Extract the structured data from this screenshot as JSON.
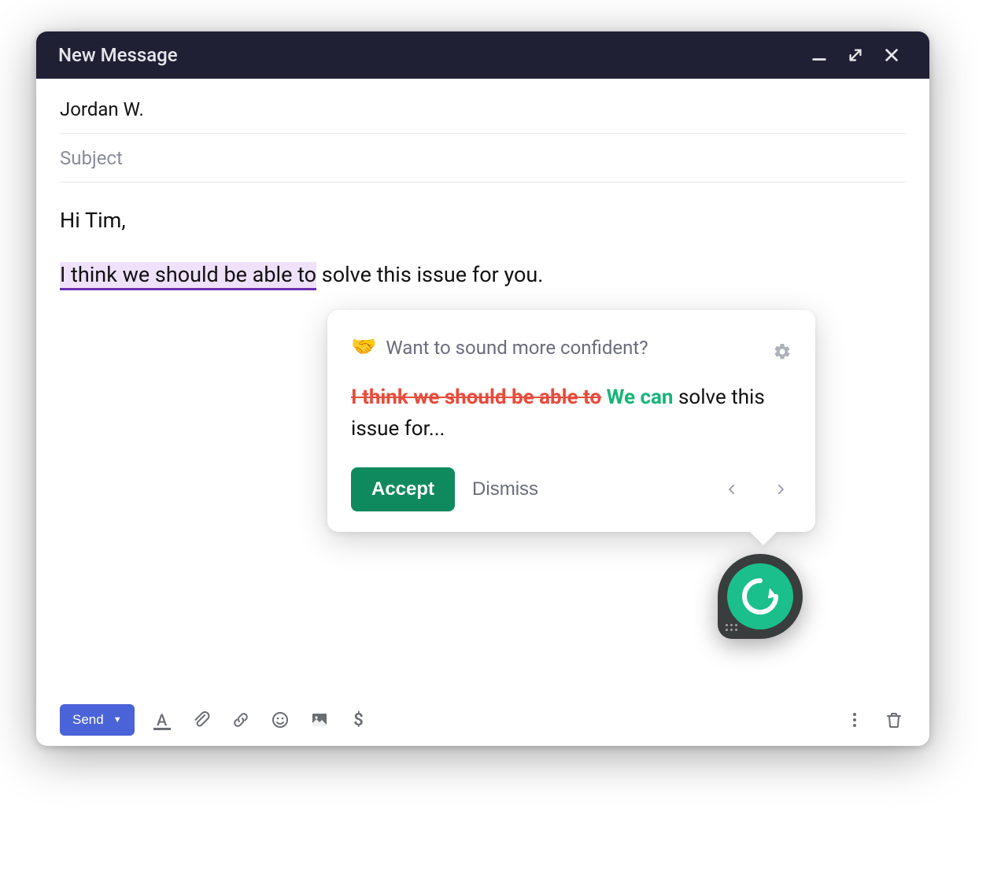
{
  "window": {
    "title": "New Message"
  },
  "compose": {
    "to_value": "Jordan W.",
    "subject_placeholder": "Subject",
    "body": {
      "greeting": "Hi Tim,",
      "sentence_highlighted": "I think we should be able to",
      "sentence_rest": " solve this issue for you."
    }
  },
  "suggestion": {
    "emoji": "🤝",
    "title": "Want to sound more confident?",
    "strike_text": "I think we should be able to",
    "replacement_text": "We can",
    "trailing_text": " solve this issue for...",
    "accept_label": "Accept",
    "dismiss_label": "Dismiss"
  },
  "toolbar": {
    "send_label": "Send"
  },
  "colors": {
    "titlebar_bg": "#1f2034",
    "highlight_bg": "#efe1f9",
    "highlight_underline": "#6a2fb0",
    "strike": "#e74c3c",
    "replacement": "#18b57a",
    "accept_btn": "#0f8a5f",
    "send_btn": "#4a63d8",
    "grammarly_green": "#1bbf8b"
  },
  "icons": {
    "minimize": "minimize-icon",
    "expand": "expand-icon",
    "close": "close-icon",
    "gear": "gear-icon",
    "prev": "chevron-left-icon",
    "next": "chevron-right-icon",
    "text_format": "text-format-icon",
    "attach": "paperclip-icon",
    "link": "link-icon",
    "emoji": "emoji-icon",
    "image": "image-icon",
    "money": "dollar-icon",
    "more": "more-vert-icon",
    "trash": "trash-icon",
    "grammarly": "grammarly-icon"
  }
}
